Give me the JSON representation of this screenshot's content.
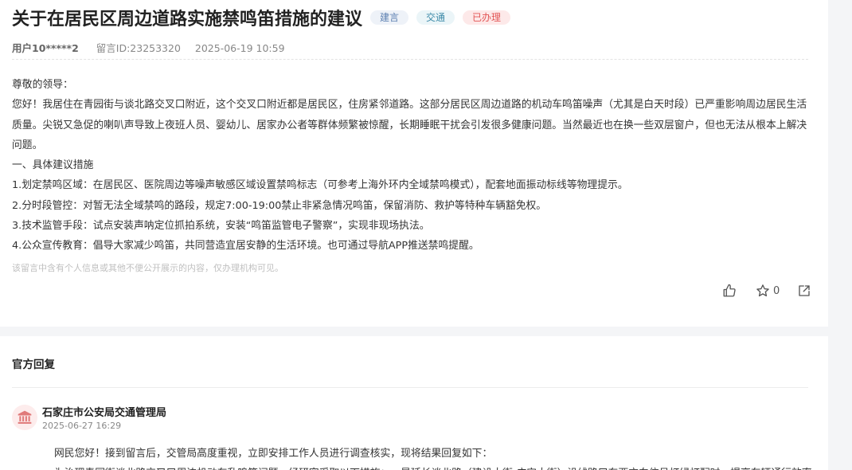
{
  "message": {
    "title": "关于在居民区周边道路实施禁鸣笛措施的建议",
    "tags": [
      "建言",
      "交通",
      "已办理"
    ],
    "user": "用户10*****2",
    "message_id": "留言ID:23253320",
    "datetime": "2025-06-19 10:59",
    "body": [
      "尊敬的领导：",
      "您好！我居住在青园街与谈北路交叉口附近，这个交叉口附近都是居民区，住房紧邻道路。这部分居民区周边道路的机动车鸣笛噪声（尤其是白天时段）已严重影响周边居民生活质量。尖锐又急促的喇叭声导致上夜班人员、婴幼儿、居家办公者等群体频繁被惊醒，长期睡眠干扰会引发很多健康问题。当然最近也在换一些双层窗户，但也无法从根本上解决问题。",
      "一、具体建议措施",
      "1.划定禁鸣区域：在居民区、医院周边等噪声敏感区域设置禁鸣标志（可参考上海外环内全域禁鸣模式），配套地面振动标线等物理提示。",
      "2.分时段管控：对暂无法全域禁鸣的路段，规定7:00-19:00禁止非紧急情况鸣笛，保留消防、救护等特种车辆豁免权。",
      "3.技术监管手段：试点安装声呐定位抓拍系统，安装“鸣笛监管电子警察”，实现非现场执法。",
      "4.公众宣传教育：倡导大家减少鸣笛，共同营造宜居安静的生活环境。也可通过导航APP推送禁鸣提醒。"
    ],
    "privacy_note": "该留言中含有个人信息或其他不便公开展示的内容，仅办理机构可见。",
    "star_count": "0"
  },
  "reply": {
    "section_title": "官方回复",
    "org_name": "石家庄市公安局交通管理局",
    "datetime": "2025-06-27 16:29",
    "text": [
      "网民您好！接到留言后，交管局高度重视，立即安排工作人员进行调查核实，现将结果回复如下：",
      "为治理青园街谈北路交叉口周边机动车乱鸣笛问题，经研究采取以下措施：一是延长谈北路（建设大街-广安大街）沿线路口东西方向信号灯绿灯配时，提高车辆通行效率"
    ]
  },
  "colors": {
    "tag_blue": "#5b7fb0",
    "tag_teal": "#3c8aa8",
    "tag_red": "#e25555",
    "org_icon": "#e07a7a"
  },
  "icons": [
    "thumbs-up-icon",
    "star-icon",
    "share-icon",
    "government-building-icon"
  ]
}
